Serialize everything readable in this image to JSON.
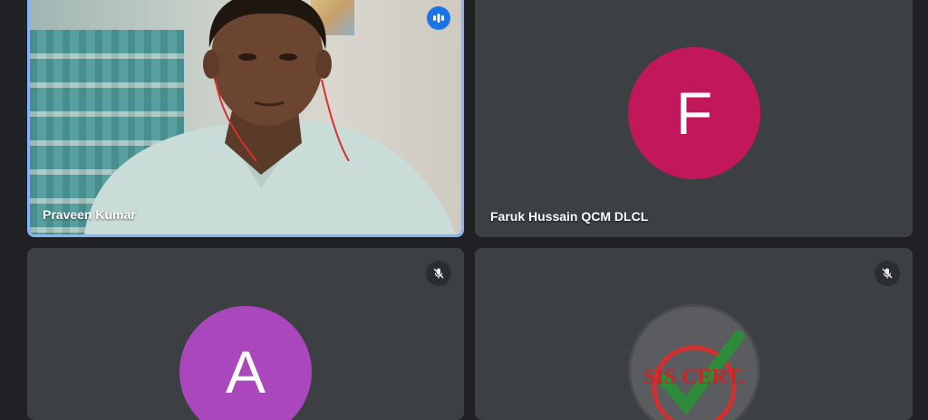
{
  "participants": [
    {
      "name": "Praveen Kumar",
      "type": "video",
      "speaking": true
    },
    {
      "name": "Faruk Hussain QCM DLCL",
      "type": "avatar",
      "initial": "F",
      "avatar_color": "#c2185b"
    },
    {
      "name": "",
      "type": "avatar",
      "initial": "A",
      "avatar_color": "#ab47bc",
      "muted": true
    },
    {
      "name": "",
      "type": "logo",
      "logo_text": "SIS CERT.",
      "muted": true
    }
  ],
  "colors": {
    "background": "#202124",
    "tile": "#3c4043",
    "active_border": "#8ab4f8",
    "speaking_badge": "#1a73e8"
  },
  "icons": {
    "speaking": "audio-level-icon",
    "muted": "mic-off-icon"
  }
}
